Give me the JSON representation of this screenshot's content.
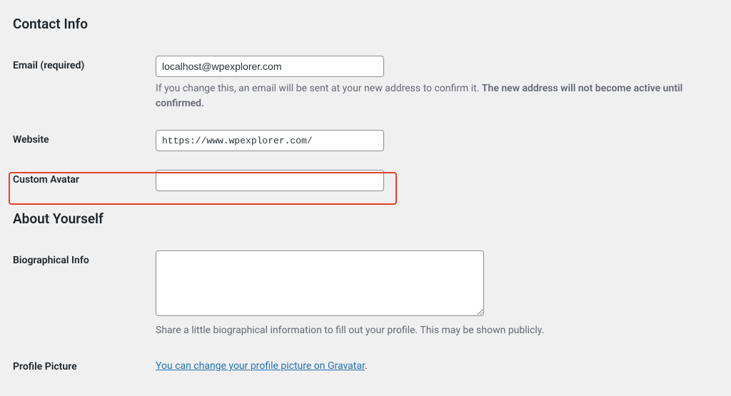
{
  "sections": {
    "contact": {
      "heading": "Contact Info",
      "email": {
        "label": "Email (required)",
        "value": "localhost@wpexplorer.com",
        "description_prefix": "If you change this, an email will be sent at your new address to confirm it. ",
        "description_strong": "The new address will not become active until confirmed."
      },
      "website": {
        "label": "Website",
        "value": "https://www.wpexplorer.com/"
      },
      "custom_avatar": {
        "label": "Custom Avatar",
        "value": ""
      }
    },
    "about": {
      "heading": "About Yourself",
      "bio": {
        "label": "Biographical Info",
        "value": "",
        "description": "Share a little biographical information to fill out your profile. This may be shown publicly."
      },
      "profile_picture": {
        "label": "Profile Picture",
        "link_text": "You can change your profile picture on Gravatar",
        "link_suffix": "."
      }
    }
  }
}
